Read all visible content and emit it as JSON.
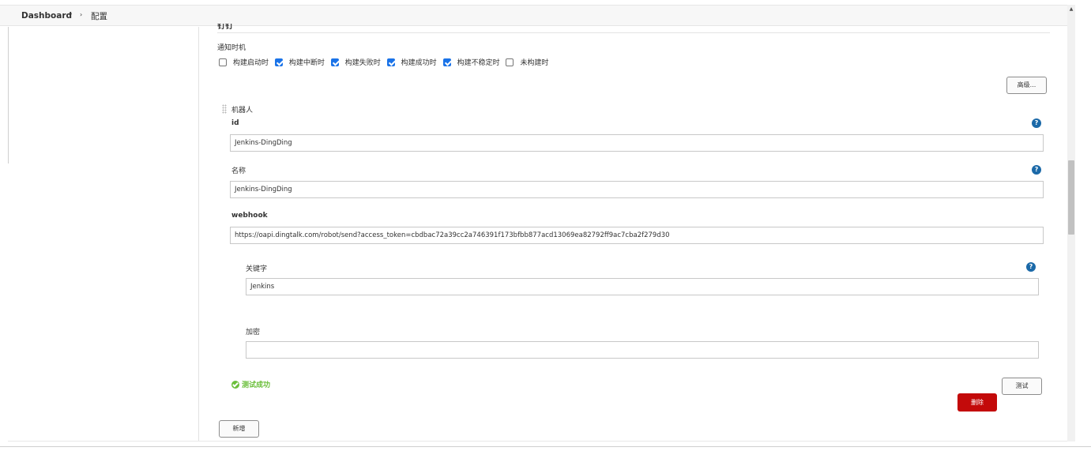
{
  "breadcrumb": {
    "dashboard": "Dashboard",
    "caret": "▾",
    "separator": "›",
    "current": "配置"
  },
  "section_heading_partial": "钉钉",
  "notify": {
    "label": "通知时机",
    "options": [
      {
        "label": "构建启动时",
        "checked": false
      },
      {
        "label": "构建中断时",
        "checked": true
      },
      {
        "label": "构建失败时",
        "checked": true
      },
      {
        "label": "构建成功时",
        "checked": true
      },
      {
        "label": "构建不稳定时",
        "checked": true
      },
      {
        "label": "未构建时",
        "checked": false
      }
    ]
  },
  "buttons": {
    "advanced": "高级...",
    "test": "测试",
    "delete": "删除",
    "add": "新增"
  },
  "robot": {
    "label": "机器人",
    "id_label": "id",
    "id_value": "Jenkins-DingDing",
    "name_label": "名称",
    "name_value": "Jenkins-DingDing",
    "webhook_label": "webhook",
    "webhook_value": "https://oapi.dingtalk.com/robot/send?access_token=cbdbac72a39cc2a746391f173bfbb877acd13069ea82792ff9ac7cba2f279d30",
    "keyword_label": "关键字",
    "keyword_value": "Jenkins",
    "secret_label": "加密",
    "secret_value": ""
  },
  "help_glyph": "?",
  "status": {
    "test_success": "测试成功"
  },
  "colors": {
    "checkbox_checked": "#1a73e8",
    "help_icon": "#1b69a8",
    "delete_button": "#c30a0a",
    "success": "#6bbf3b"
  }
}
